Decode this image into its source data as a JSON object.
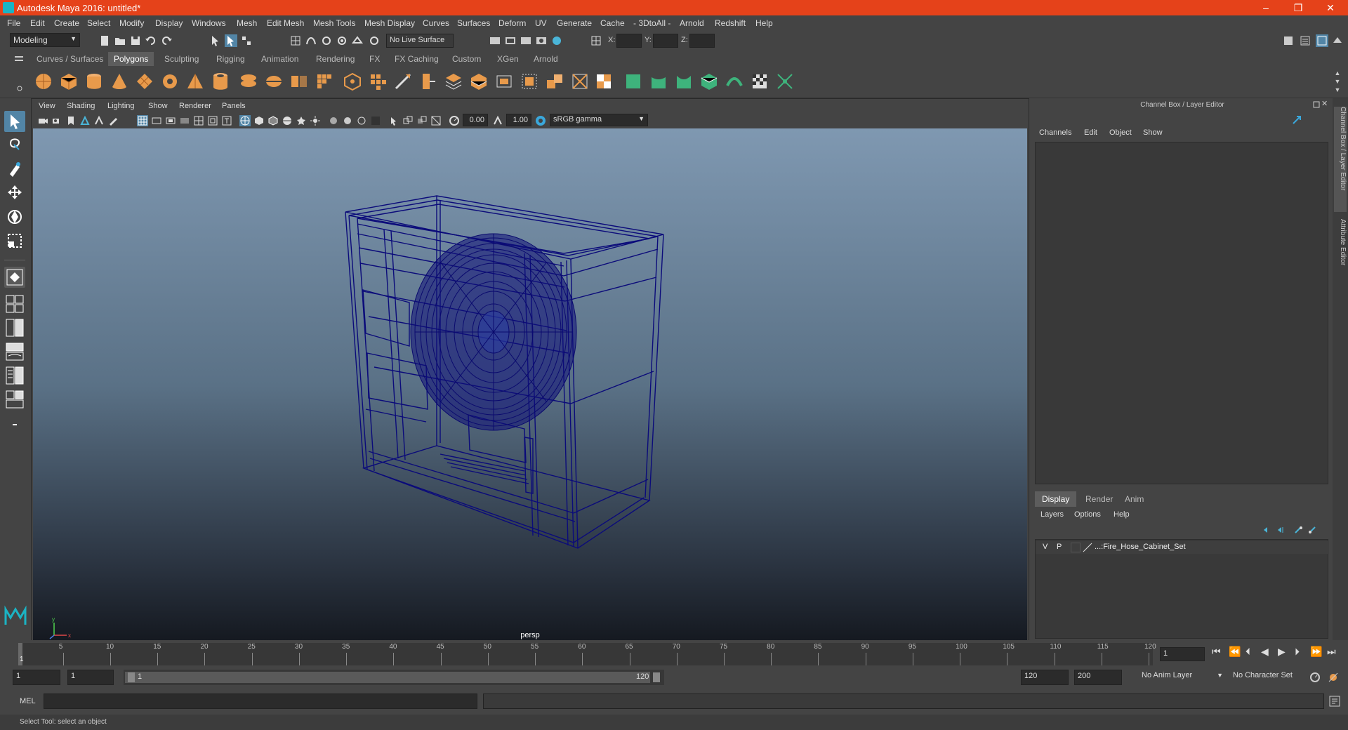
{
  "window": {
    "title": "Autodesk Maya 2016: untitled*",
    "controls": [
      "–",
      "❐",
      "✕"
    ]
  },
  "menubar": {
    "items": [
      "File",
      "Edit",
      "Create",
      "Select",
      "Modify",
      "Display",
      "Windows",
      "Mesh",
      "Edit Mesh",
      "Mesh Tools",
      "Mesh Display",
      "Curves",
      "Surfaces",
      "Deform",
      "UV",
      "Generate",
      "Cache",
      "- 3DtoAll -",
      "Arnold",
      "Redshift",
      "Help"
    ]
  },
  "statusline": {
    "mode": "Modeling",
    "live_surface": "No Live Surface",
    "x_label": "X:",
    "y_label": "Y:",
    "z_label": "Z:"
  },
  "shelf": {
    "tabs": [
      "Curves / Surfaces",
      "Polygons",
      "Sculpting",
      "Rigging",
      "Animation",
      "Rendering",
      "FX",
      "FX Caching",
      "Custom",
      "XGen",
      "Arnold"
    ],
    "active_tab": "Polygons"
  },
  "viewport": {
    "menu": [
      "View",
      "Shading",
      "Lighting",
      "Show",
      "Renderer",
      "Panels"
    ],
    "exposure": "0.00",
    "gamma": "1.00",
    "color_space": "sRGB gamma",
    "camera_label": "persp"
  },
  "channelbox": {
    "title": "Channel Box / Layer Editor",
    "menu": [
      "Channels",
      "Edit",
      "Object",
      "Show"
    ],
    "tabs": [
      "Display",
      "Render",
      "Anim"
    ],
    "active_tab": "Display",
    "layer_menu": [
      "Layers",
      "Options",
      "Help"
    ],
    "layer": {
      "v": "V",
      "p": "P",
      "name": "...:Fire_Hose_Cabinet_Set"
    }
  },
  "side_tabs": [
    "Channel Box / Layer Editor",
    "Attribute Editor"
  ],
  "timeslider": {
    "ticks": [
      "5",
      "10",
      "15",
      "20",
      "25",
      "30",
      "35",
      "40",
      "45",
      "50",
      "55",
      "60",
      "65",
      "70",
      "75",
      "80",
      "85",
      "90",
      "95",
      "100",
      "105",
      "110",
      "115",
      "120"
    ],
    "start_marker": "1",
    "current_frame": "1"
  },
  "rangeslider": {
    "start": "1",
    "playback_start": "1",
    "range_start_label": "1",
    "range_end_label": "120",
    "playback_end": "120",
    "end": "200",
    "anim_layer": "No Anim Layer",
    "character_set": "No Character Set"
  },
  "cmdline": {
    "label": "MEL"
  },
  "helpline": {
    "text": "Select Tool: select an object"
  },
  "colors": {
    "title_bar": "#e5421a",
    "selected_tool": "#5285a6",
    "wireframe": "#0b0b7a",
    "shelf_icon": "#e89a4b",
    "shelf_icon_green": "#3eb37c"
  }
}
